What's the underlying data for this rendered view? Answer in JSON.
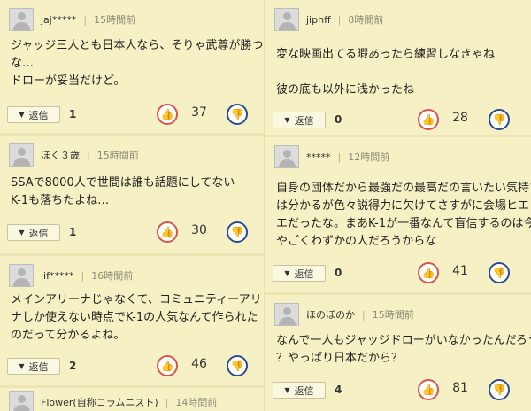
{
  "comments_left": [
    {
      "user": "jaj*****",
      "time": "15時間前",
      "lines": [
        "ジャッジ三人とも日本人なら、そりゃ武尊が勝つ",
        "な…",
        "ドローが妥当だけど。"
      ],
      "reply_label": "返信",
      "reply_count": "1",
      "likes": "37"
    },
    {
      "user": "ぼく３歳",
      "time": "15時間前",
      "lines": [
        "SSAで8000人で世間は誰も話題にしてない",
        "K-1も落ちたよね…"
      ],
      "reply_label": "返信",
      "reply_count": "1",
      "likes": "30"
    },
    {
      "user": "lif*****",
      "time": "16時間前",
      "lines": [
        "メインアリーナじゃなくて、コミュニティーアリ",
        "ナしか使えない時点でK-1の人気なんて作られた",
        "のだって分かるよね。"
      ],
      "reply_label": "返信",
      "reply_count": "2",
      "likes": "46"
    },
    {
      "user": "Flower(自称コラムニスト)",
      "time": "14時間前",
      "lines": []
    }
  ],
  "comments_right": [
    {
      "user": "jiphff",
      "time": "8時間前",
      "lines": [
        "変な映画出てる暇あったら練習しなきゃね",
        "",
        "彼の底も以外に浅かったね"
      ],
      "reply_label": "返信",
      "reply_count": "0",
      "likes": "28"
    },
    {
      "user": "*****",
      "time": "12時間前",
      "lines": [
        "自身の団体だから最強だの最高だの言いたい気持ち",
        "は分かるが色々説得力に欠けてさすがに会場ヒエ",
        "エだったな。まあK-1が一番なんて盲信するのは今",
        "やごくわずかの人だろうからな"
      ],
      "reply_label": "返信",
      "reply_count": "0",
      "likes": "41"
    },
    {
      "user": "ほのぼのか",
      "time": "15時間前",
      "lines": [
        "なんで一人もジャッジドローがいなかったんだろう",
        "？やっぱり日本だから？"
      ],
      "reply_label": "返信",
      "reply_count": "4",
      "likes": "81"
    }
  ],
  "icons": {
    "thumb_up": "thumbs-up-icon",
    "thumb_down": "thumbs-down-icon",
    "avatar": "default-avatar-icon",
    "reply_arrow": "triangle-down-icon"
  },
  "colors": {
    "background": "#f6f1c4",
    "like": "#d9534f",
    "dislike": "#2d4a8f"
  }
}
